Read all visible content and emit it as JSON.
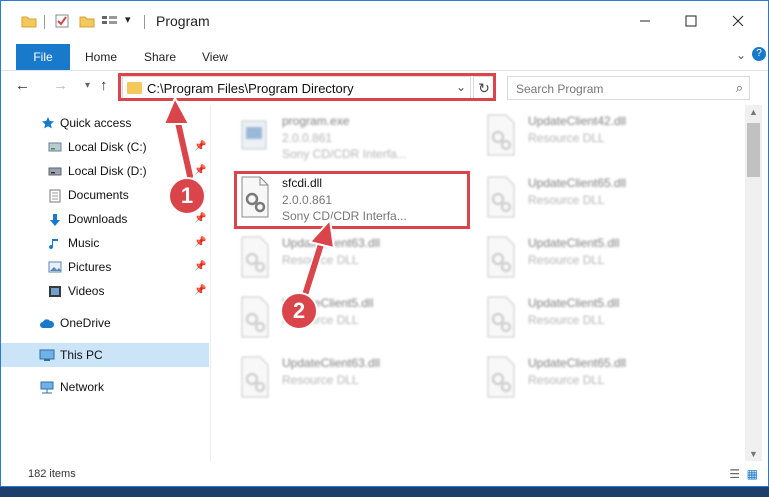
{
  "window": {
    "title": "Program"
  },
  "ribbon": {
    "tabs": [
      "File",
      "Home",
      "Share",
      "View"
    ],
    "expand_glyph": "⌄",
    "help_glyph": "?"
  },
  "nav": {
    "address_path": "C:\\Program Files\\Program Directory",
    "search_placeholder": "Search Program"
  },
  "sidebar": {
    "items": [
      {
        "label": "Quick access",
        "icon": "star-icon",
        "pinned": false
      },
      {
        "label": "Local Disk (C:)",
        "icon": "drive-icon",
        "pinned": true
      },
      {
        "label": "Local Disk (D:)",
        "icon": "drive-icon",
        "pinned": true
      },
      {
        "label": "Documents",
        "icon": "documents-icon",
        "pinned": true
      },
      {
        "label": "Downloads",
        "icon": "download-icon",
        "pinned": true
      },
      {
        "label": "Music",
        "icon": "music-icon",
        "pinned": true
      },
      {
        "label": "Pictures",
        "icon": "pictures-icon",
        "pinned": true
      },
      {
        "label": "Videos",
        "icon": "videos-icon",
        "pinned": true
      },
      {
        "label": "OneDrive",
        "icon": "cloud-icon",
        "pinned": false
      },
      {
        "label": "This PC",
        "icon": "pc-icon",
        "pinned": false
      },
      {
        "label": "Network",
        "icon": "network-icon",
        "pinned": false
      }
    ]
  },
  "files": [
    {
      "name": "program.exe",
      "line2": "2.0.0.861",
      "line3": "Sony CD/CDR Interfa..."
    },
    {
      "name": "UpdateClient42.dll",
      "line2": "Resource DLL",
      "line3": ""
    },
    {
      "name": "sfcdi.dll",
      "line2": "2.0.0.861",
      "line3": "Sony CD/CDR Interfa..."
    },
    {
      "name": "UpdateClient65.dll",
      "line2": "Resource DLL",
      "line3": ""
    },
    {
      "name": "UpdateClient63.dll",
      "line2": "Resource DLL",
      "line3": ""
    },
    {
      "name": "UpdateClient5.dll",
      "line2": "Resource DLL",
      "line3": ""
    },
    {
      "name": "UpdateClient5.dll",
      "line2": "Resource DLL",
      "line3": ""
    },
    {
      "name": "UpdateClient5.dll",
      "line2": "Resource DLL",
      "line3": ""
    },
    {
      "name": "UpdateClient63.dll",
      "line2": "Resource DLL",
      "line3": ""
    },
    {
      "name": "UpdateClient65.dll",
      "line2": "Resource DLL",
      "line3": ""
    }
  ],
  "status": {
    "item_count": "182 items"
  },
  "callouts": {
    "step1": "1",
    "step2": "2",
    "color": "#d9454a"
  },
  "colors": {
    "accent": "#1979ca",
    "highlight_red": "#d9454a",
    "folder_yellow": "#f5c85b",
    "selected_bg": "#cce4f7"
  }
}
